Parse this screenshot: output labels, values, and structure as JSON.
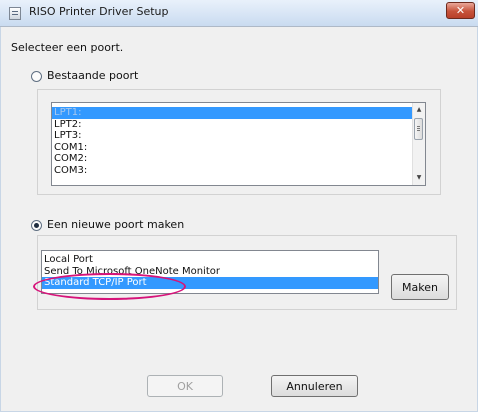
{
  "window": {
    "title": "RISO Printer Driver Setup",
    "close_glyph": "✕",
    "app_icon": "printer-app-icon"
  },
  "instruction": "Selecteer een poort.",
  "existing_port": {
    "label": "Bestaande poort",
    "selected": false,
    "items": [
      "LPT1:",
      "LPT2:",
      "LPT3:",
      "COM1:",
      "COM2:",
      "COM3:"
    ],
    "selected_item": "LPT1:"
  },
  "new_port": {
    "label": "Een nieuwe poort maken",
    "selected": true,
    "items": [
      "Local Port",
      "Send To Microsoft OneNote Monitor",
      "Standard TCP/IP Port"
    ],
    "selected_item": "Standard TCP/IP Port",
    "make_button": "Maken"
  },
  "buttons": {
    "ok": "OK",
    "cancel": "Annuleren"
  },
  "colors": {
    "selection": "#3399ff",
    "highlight_ellipse": "#d6147a",
    "title_gradient_top": "#e9f1fb",
    "close_button": "#c7533b"
  }
}
